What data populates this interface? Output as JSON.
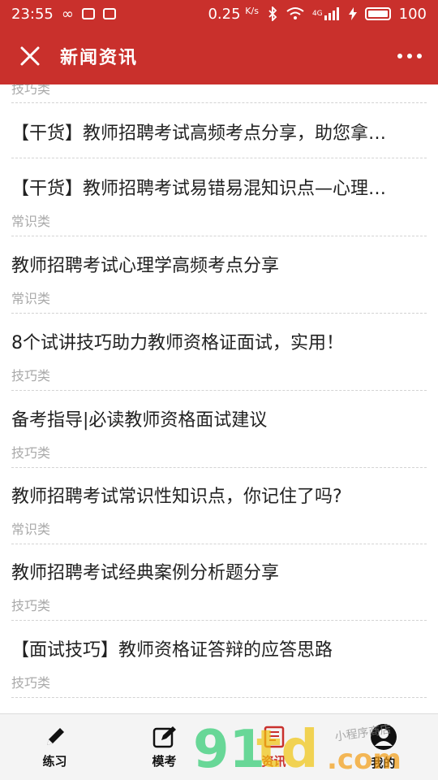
{
  "status_bar": {
    "time": "23:55",
    "speed": "0.25",
    "speed_unit": "K/s",
    "network": "4G",
    "battery": "100"
  },
  "header": {
    "title": "新闻资讯"
  },
  "news": {
    "top_tag": "技巧类",
    "items": [
      {
        "title": "【干货】教师招聘考试高频考点分享，助您拿…",
        "tag": ""
      },
      {
        "title": "【干货】教师招聘考试易错易混知识点—心理…",
        "tag": "常识类"
      },
      {
        "title": "教师招聘考试心理学高频考点分享",
        "tag": "常识类"
      },
      {
        "title": "8个试讲技巧助力教师资格证面试，实用！",
        "tag": "技巧类"
      },
      {
        "title": "备考指导|必读教师资格面试建议",
        "tag": "技巧类"
      },
      {
        "title": "教师招聘考试常识性知识点，你记住了吗?",
        "tag": "常识类"
      },
      {
        "title": "教师招聘考试经典案例分析题分享",
        "tag": "技巧类"
      },
      {
        "title": "【面试技巧】教师资格证答辩的应答思路",
        "tag": "技巧类"
      }
    ]
  },
  "bottom_nav": {
    "items": [
      {
        "label": "练习",
        "icon": "pencil-icon"
      },
      {
        "label": "模考",
        "icon": "edit-icon"
      },
      {
        "label": "资讯",
        "icon": "news-icon"
      },
      {
        "label": "我的",
        "icon": "user-icon"
      }
    ],
    "active": "资讯"
  },
  "watermark": {
    "text": "91td.com",
    "handwriting": "小程序商店"
  },
  "colors": {
    "accent": "#c9302c",
    "tag": "#aaaaaa",
    "divider": "#d3d3d3"
  }
}
